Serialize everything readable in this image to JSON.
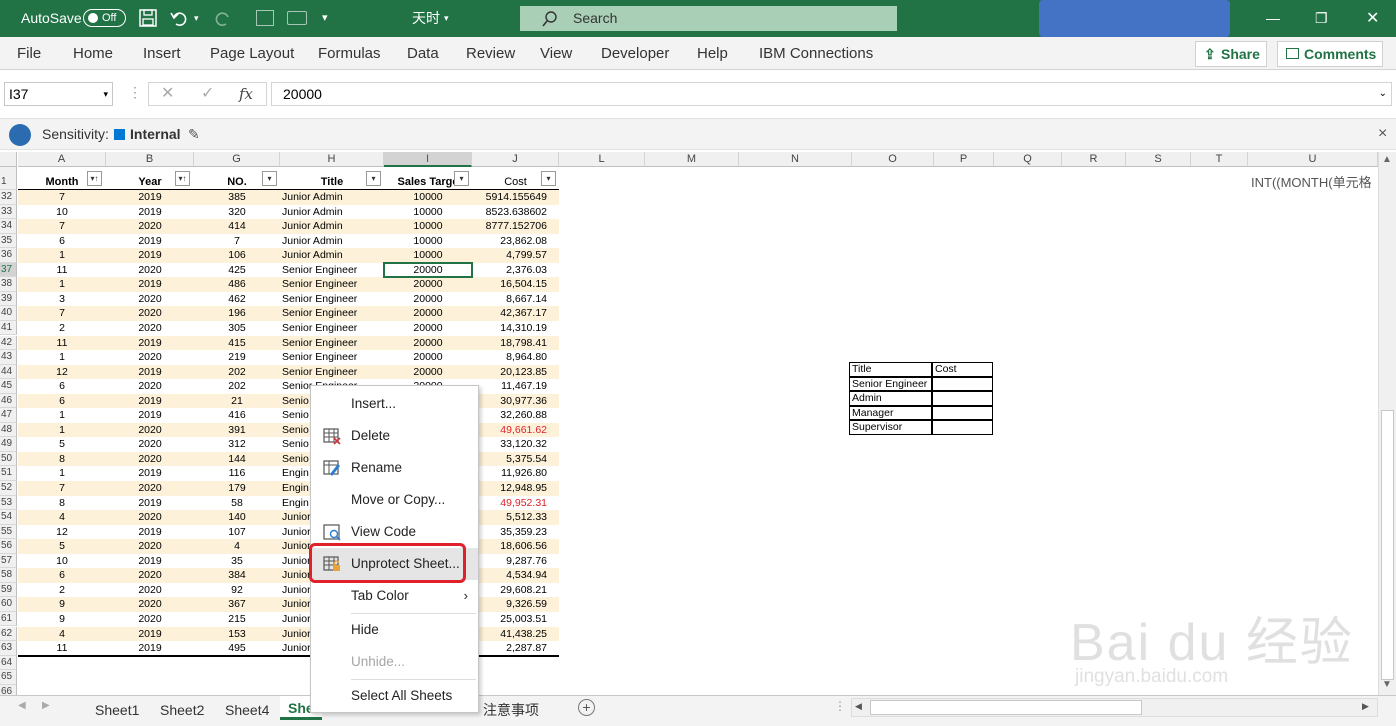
{
  "titlebar": {
    "autosave": "AutoSave",
    "toggle": "Off",
    "filename": "天时",
    "search_placeholder": "Search",
    "min": "—",
    "restore": "❐",
    "close": "✕"
  },
  "ribbon": {
    "tabs": [
      "File",
      "Home",
      "Insert",
      "Page Layout",
      "Formulas",
      "Data",
      "Review",
      "View",
      "Developer",
      "Help",
      "IBM Connections"
    ],
    "share": "Share",
    "comments": "Comments"
  },
  "formula_bar": {
    "name_box": "I37",
    "value": "20000",
    "fx": "fx"
  },
  "sensitivity": {
    "label": "Sensitivity:",
    "value": "Internal",
    "close": "×"
  },
  "columns": [
    "A",
    "B",
    "G",
    "H",
    "I",
    "J",
    "L",
    "M",
    "N",
    "O",
    "P",
    "Q",
    "R",
    "S",
    "T",
    "U"
  ],
  "header_row": {
    "num": "1",
    "month": "Month",
    "year": "Year",
    "no": "NO.",
    "title": "Title",
    "sales": "Sales Targe",
    "cost": "Cost"
  },
  "overflow_text": "INT((MONTH(单元格",
  "rows": [
    [
      "32",
      "7",
      "2019",
      "385",
      "Junior Admin",
      "10000",
      "5914.155649"
    ],
    [
      "33",
      "10",
      "2019",
      "320",
      "Junior Admin",
      "10000",
      "8523.638602"
    ],
    [
      "34",
      "7",
      "2020",
      "414",
      "Junior Admin",
      "10000",
      "8777.152706"
    ],
    [
      "35",
      "6",
      "2019",
      "7",
      "Junior Admin",
      "10000",
      "23,862.08"
    ],
    [
      "36",
      "1",
      "2019",
      "106",
      "Junior Admin",
      "10000",
      "4,799.57"
    ],
    [
      "37",
      "11",
      "2020",
      "425",
      "Senior Engineer",
      "20000",
      "2,376.03"
    ],
    [
      "38",
      "1",
      "2019",
      "486",
      "Senior Engineer",
      "20000",
      "16,504.15"
    ],
    [
      "39",
      "3",
      "2020",
      "462",
      "Senior Engineer",
      "20000",
      "8,667.14"
    ],
    [
      "40",
      "7",
      "2020",
      "196",
      "Senior Engineer",
      "20000",
      "42,367.17"
    ],
    [
      "41",
      "2",
      "2020",
      "305",
      "Senior Engineer",
      "20000",
      "14,310.19"
    ],
    [
      "42",
      "11",
      "2019",
      "415",
      "Senior Engineer",
      "20000",
      "18,798.41"
    ],
    [
      "43",
      "1",
      "2020",
      "219",
      "Senior Engineer",
      "20000",
      "8,964.80"
    ],
    [
      "44",
      "12",
      "2019",
      "202",
      "Senior Engineer",
      "20000",
      "20,123.85"
    ],
    [
      "45",
      "6",
      "2020",
      "202",
      "Senior Engineer",
      "20000",
      "11,467.19"
    ],
    [
      "46",
      "6",
      "2019",
      "21",
      "Senio",
      "",
      "30,977.36"
    ],
    [
      "47",
      "1",
      "2019",
      "416",
      "Senio",
      "",
      "32,260.88"
    ],
    [
      "48",
      "1",
      "2020",
      "391",
      "Senio",
      "",
      "49,661.62"
    ],
    [
      "49",
      "5",
      "2020",
      "312",
      "Senio",
      "",
      "33,120.32"
    ],
    [
      "50",
      "8",
      "2020",
      "144",
      "Senio",
      "",
      "5,375.54"
    ],
    [
      "51",
      "1",
      "2019",
      "116",
      "Engin",
      "",
      "11,926.80"
    ],
    [
      "52",
      "7",
      "2020",
      "179",
      "Engin",
      "",
      "12,948.95"
    ],
    [
      "53",
      "8",
      "2019",
      "58",
      "Engin",
      "",
      "49,952.31"
    ],
    [
      "54",
      "4",
      "2020",
      "140",
      "Junior",
      "",
      "5,512.33"
    ],
    [
      "55",
      "12",
      "2019",
      "107",
      "Junior",
      "",
      "35,359.23"
    ],
    [
      "56",
      "5",
      "2020",
      "4",
      "Junior",
      "",
      "18,606.56"
    ],
    [
      "57",
      "10",
      "2019",
      "35",
      "Junior",
      "",
      "9,287.76"
    ],
    [
      "58",
      "6",
      "2020",
      "384",
      "Junior",
      "",
      "4,534.94"
    ],
    [
      "59",
      "2",
      "2020",
      "92",
      "Junior",
      "",
      "29,608.21"
    ],
    [
      "60",
      "9",
      "2020",
      "367",
      "Junior",
      "",
      "9,326.59"
    ],
    [
      "61",
      "9",
      "2020",
      "215",
      "Junior",
      "",
      "25,003.51"
    ],
    [
      "62",
      "4",
      "2019",
      "153",
      "Junior",
      "",
      "41,438.25"
    ],
    [
      "63",
      "11",
      "2019",
      "495",
      "Junior",
      "",
      "2,287.87"
    ],
    [
      "64",
      "",
      "",
      "",
      "",
      "",
      ""
    ],
    [
      "65",
      "",
      "",
      "",
      "",
      "",
      ""
    ],
    [
      "66",
      "",
      "",
      "",
      "",
      "",
      ""
    ]
  ],
  "red_rows": [
    "48",
    "53"
  ],
  "summary_table": {
    "headers": [
      "Title",
      "Cost"
    ],
    "rows": [
      "Senior Engineer",
      "Admin",
      "Manager",
      "Supervisor"
    ]
  },
  "context_menu": [
    "Insert...",
    "Delete",
    "Rename",
    "Move or Copy...",
    "View Code",
    "Unprotect Sheet...",
    "Tab Color",
    "Hide",
    "Unhide...",
    "Select All Sheets"
  ],
  "sheet_tabs": [
    "Sheet1",
    "Sheet2",
    "Sheet4",
    "She",
    "注意事项"
  ],
  "colors": {
    "excel_green": "#217346",
    "highlight_red": "#e0202a",
    "band": "#fdf2d9"
  }
}
